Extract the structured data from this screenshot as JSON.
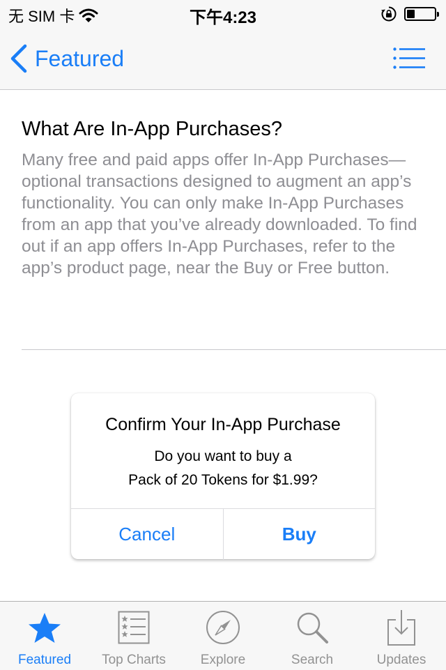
{
  "status_bar": {
    "carrier": "无 SIM 卡",
    "time": "下午4:23",
    "battery_level": 0.3,
    "icons": [
      "wifi-icon",
      "rotation-lock-icon",
      "battery-icon"
    ]
  },
  "nav": {
    "back_label": "Featured",
    "icons": [
      "back-chevron-icon",
      "list-icon"
    ]
  },
  "article": {
    "title": "What Are In-App Purchases?",
    "body": "Many free and paid apps offer In-App Purchases—optional transactions designed to augment an app’s functionality. You can only make In-App Purchases from an app that you’ve already downloaded. To find out if an app offers In-App Purchases, refer to the app’s product page, near the Buy or Free button."
  },
  "dialog": {
    "title": "Confirm Your In-App Purchase",
    "message_line1": "Do you want to buy a",
    "message_line2": "Pack of 20 Tokens for $1.99?",
    "cancel_label": "Cancel",
    "buy_label": "Buy"
  },
  "tab_bar": {
    "tabs": [
      {
        "label": "Featured",
        "icon": "star-icon",
        "active": true
      },
      {
        "label": "Top Charts",
        "icon": "top-charts-icon",
        "active": false
      },
      {
        "label": "Explore",
        "icon": "compass-icon",
        "active": false
      },
      {
        "label": "Search",
        "icon": "search-icon",
        "active": false
      },
      {
        "label": "Updates",
        "icon": "updates-icon",
        "active": false
      }
    ]
  },
  "colors": {
    "accent": "#1a7ef7",
    "body_text": "#8e8e93",
    "inactive_tab": "#929292",
    "bar_background": "#f7f7f7"
  }
}
